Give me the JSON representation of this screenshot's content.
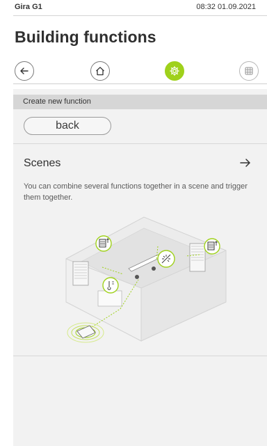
{
  "status": {
    "device": "Gira G1",
    "datetime": "08:32 01.09.2021"
  },
  "page": {
    "title": "Building functions"
  },
  "nav": {
    "icons": [
      "arrow-left-icon",
      "home-icon",
      "gear-icon",
      "grid-icon"
    ],
    "active_index": 2,
    "accent_color": "#9fd11b"
  },
  "section": {
    "header": "Create new function"
  },
  "back_button": {
    "label": "back"
  },
  "item": {
    "title": "Scenes",
    "description": "You can combine several functions together in a scene and trigger them together."
  }
}
